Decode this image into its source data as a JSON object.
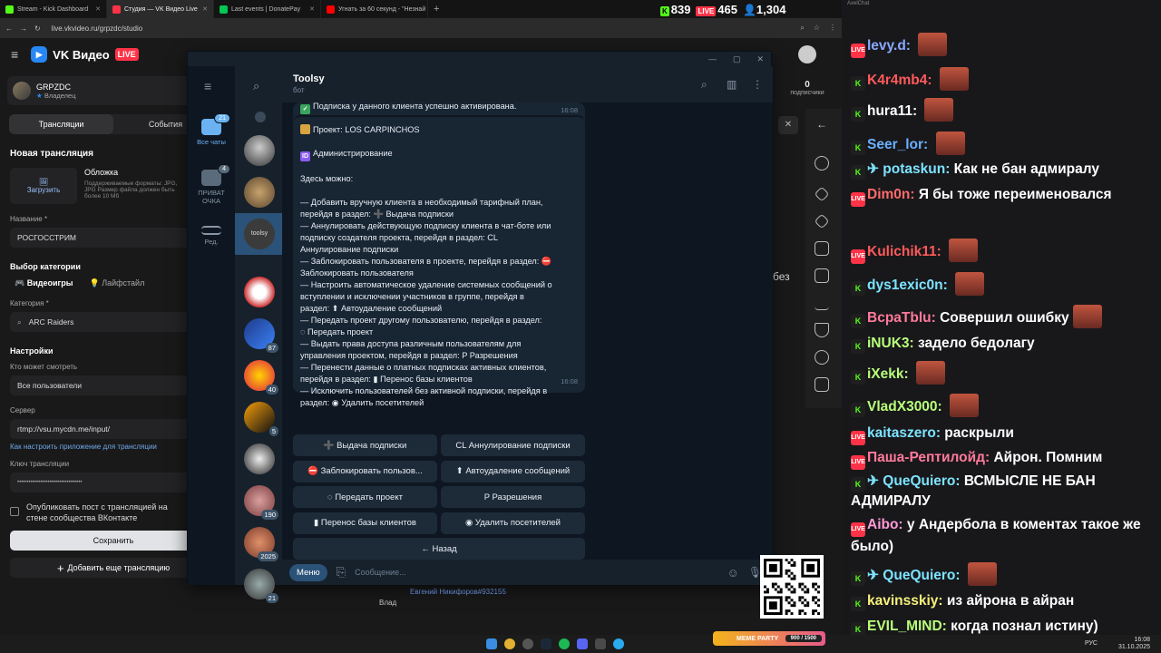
{
  "browser": {
    "tabs": [
      {
        "label": "Stream - Kick Dashboard",
        "color": "#53fc18"
      },
      {
        "label": "Студия — VK Видео Live",
        "color": "#ff3347"
      },
      {
        "label": "Last events | DonatePay",
        "color": "#00c853"
      },
      {
        "label": "Угнать за 60 секунд - \"Незнай",
        "color": "#ff0000"
      }
    ],
    "url": "live.vkvideo.ru/grpzdc/studio",
    "stats": {
      "kick": "839",
      "vk": "465",
      "viewers": "1,304",
      "kick_badge": "K",
      "vk_badge": "LIVE"
    }
  },
  "vk": {
    "logo": "VK Видео",
    "live_badge": "LIVE",
    "profile_name": "GRPZDC",
    "profile_role": "Владелец",
    "tabs": [
      "Трансляции",
      "События"
    ],
    "new_stream": "Новая трансляция",
    "cover_label": "Обложка",
    "upload_label": "Загрузить",
    "cover_hint": "Поддерживаемые форматы: JPG, JPG Размер файла должен быть более 10 Мб",
    "name_label": "Название *",
    "name_value": "РОСГОССТРИМ",
    "category_section": "Выбор категории",
    "cat_games": "Видеоигры",
    "cat_lifestyle": "Лайфстайл",
    "category_label": "Категория *",
    "category_value": "ARC Raiders",
    "settings": "Настройки",
    "who_label": "Кто может смотреть",
    "who_value": "Все пользователи",
    "server_label": "Сервер",
    "server_value": "rtmp://vsu.mycdn.me/input/",
    "howto_link": "Как настроить приложение для трансляции",
    "key_label": "Ключ трансляции",
    "key_value": "••••••••••••••••••••••••••••••••••",
    "publish_label": "Опубликовать пост с трансляцией на стене сообщества ВКонтакте",
    "save": "Сохранить",
    "add_more": "Добавить еще трансляцию",
    "subs_count": "0",
    "subs_label": "подписчики",
    "right_word": "без",
    "bottom_user": "Евгений Никифоров#932155",
    "bottom_left": "Влад"
  },
  "tg": {
    "title": "Toolsy",
    "subtitle": "бот",
    "folders": [
      {
        "label": "Все чаты",
        "badge": "21"
      },
      {
        "label": "ПРИВАТ ОЧКА",
        "badge": "4"
      },
      {
        "label": "Ред.",
        "badge": ""
      }
    ],
    "chat_counts": [
      "87",
      "40",
      "5",
      "190",
      "2025",
      "21"
    ],
    "prev_msg": "Подписка у данного клиента успешно активирована.",
    "prev_time": "16:08",
    "project_line": "Проект: LOS CARPINCHOS",
    "admin_line": "Администрирование",
    "here_line": "Здесь можно:",
    "body": [
      "— Добавить вручную клиента в необходимый тарифный план,",
      "перейдя в раздел: ➕ Выдача подписки",
      "— Аннулировать действующую подписку клиента в чат-боте или",
      "подписку создателя проекта, перейдя в раздел: CL",
      "Аннулирование подписки",
      "— Заблокировать пользователя в проекте, перейдя в раздел: ⛔",
      "Заблокировать пользователя",
      "— Настроить автоматическое удаление системных сообщений о",
      "вступлении и исключении участников в группе, перейдя в",
      "раздел: ⬆ Автоудаление сообщений",
      "— Передать проект другому пользователю, перейдя в раздел:",
      "◌ Передать проект",
      "— Выдать права доступа различным пользователям для",
      "управления проектом, перейдя в раздел: P Разрешения",
      "— Перенести данные о платных подписках активных клиентов,",
      "перейдя в раздел: ▮ Перенос базы клиентов",
      "— Исключить пользователей без активной подписки, перейдя в",
      "раздел: ◉ Удалить посетителей"
    ],
    "msg_time": "16:08",
    "buttons": [
      "➕ Выдача подписки",
      "CL Аннулирование подписки",
      "⛔ Заблокировать пользов...",
      "⬆ Автоудаление сообщений",
      "◌ Передать проект",
      "P Разрешения",
      "▮ Перенос базы клиентов",
      "◉ Удалить посетителей",
      "← Назад"
    ],
    "menu": "Меню",
    "placeholder": "Сообщение..."
  },
  "chat": {
    "title": "AxelChat",
    "lines": [
      {
        "p": "v",
        "user": "levy.d:",
        "color": "#8aa8ff",
        "text": "",
        "emote": true
      },
      {
        "p": "k",
        "user": "K4r4mb4:",
        "color": "#ff5a5a",
        "text": "",
        "emote": true
      },
      {
        "p": "k",
        "user": "hura11:",
        "color": "#ffffff",
        "text": "",
        "emote": true
      },
      {
        "p": "k",
        "user": "Seer_lor:",
        "color": "#6ab0ff",
        "text": "",
        "emote": true
      },
      {
        "p": "k",
        "user": "✈ potaskun:",
        "color": "#7de3ff",
        "text": "Как не бан адмиралу",
        "emote": false
      },
      {
        "p": "v",
        "user": "Dim0n:",
        "color": "#ff6a6a",
        "text": "Я бы тоже переименовался",
        "emote": false
      },
      {
        "p": "v",
        "user": "Kulichik11:",
        "color": "#ff5a5a",
        "text": "",
        "emote": true
      },
      {
        "p": "k",
        "user": "dys1exic0n:",
        "color": "#7de3ff",
        "text": "",
        "emote": true
      },
      {
        "p": "k",
        "user": "BcpaTblu:",
        "color": "#ff7a9a",
        "text": "Совершил ошибку",
        "emote": true
      },
      {
        "p": "k",
        "user": "iNUK3:",
        "color": "#b9ff7a",
        "text": "задело бедолагу",
        "emote": false
      },
      {
        "p": "k",
        "user": "iXekk:",
        "color": "#b9ff7a",
        "text": "",
        "emote": true
      },
      {
        "p": "k",
        "user": "VladX3000:",
        "color": "#b9ff7a",
        "text": "",
        "emote": true
      },
      {
        "p": "v",
        "user": "kaitaszero:",
        "color": "#7de3ff",
        "text": "раскрыли",
        "emote": false
      },
      {
        "p": "v",
        "user": "Паша-Рептилойд:",
        "color": "#ff7a9a",
        "text": "Айрон. Помним",
        "emote": false
      },
      {
        "p": "k",
        "user": "✈ QueQuiero:",
        "color": "#7de3ff",
        "text": "ВСМЫСЛЕ НЕ БАН АДМИРАЛУ",
        "emote": false
      },
      {
        "p": "v",
        "user": "Aibo:",
        "color": "#ff9ad8",
        "text": "у Андербола в коментах такое же было)",
        "emote": false
      },
      {
        "p": "k",
        "user": "✈ QueQuiero:",
        "color": "#7de3ff",
        "text": "",
        "emote": true
      },
      {
        "p": "k",
        "user": "kavinsskiy:",
        "color": "#f6f07a",
        "text": "из айрона в айран",
        "emote": false
      },
      {
        "p": "k",
        "user": "EVIL_MIND:",
        "color": "#b9ff7a",
        "text": "когда познал истину)",
        "emote": false
      }
    ]
  },
  "taskbar": {
    "lang": "РУС",
    "time": "16:08",
    "date": "31.10.2025"
  },
  "meme": {
    "label": "MEME PARTY",
    "progress": "900 / 1500"
  }
}
